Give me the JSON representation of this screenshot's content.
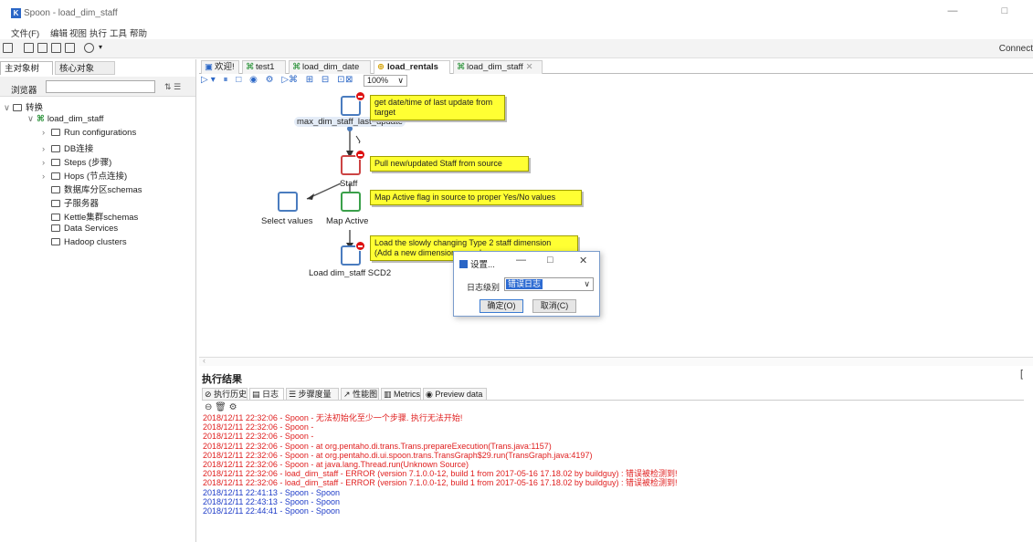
{
  "window": {
    "title": "Spoon - load_dim_staff",
    "minimize": "—",
    "maximize": "□"
  },
  "menu": [
    "文件(F)",
    "编辑",
    "视图",
    "执行",
    "工具",
    "帮助"
  ],
  "toolbar": {
    "connect": "Connect"
  },
  "left_panel": {
    "tabs": [
      "主对象树",
      "核心对象"
    ],
    "browser_label": "浏览器",
    "search_placeholder": "",
    "tree": {
      "root": "转换",
      "transformation": "load_dim_staff",
      "children": [
        "Run configurations",
        "DB连接",
        "Steps (步骤)",
        "Hops (节点连接)",
        "数据库分区schemas",
        "子服务器",
        "Kettle集群schemas",
        "Data Services",
        "Hadoop clusters"
      ]
    }
  },
  "editor_tabs": [
    "欢迎!",
    "test1",
    "load_dim_date",
    "load_rentals",
    "load_dim_staff"
  ],
  "zoom": "100%",
  "canvas": {
    "notes": [
      "get date/time of last update from target",
      "Pull new/updated Staff from source",
      "Map Active flag in source to proper Yes/No values",
      "Load the slowly changing Type 2 staff dimension",
      "(Add a new dimension record..."
    ],
    "steps": [
      "max_dim_staff_last_update",
      "Staff",
      "Select values",
      "Map Active",
      "Load dim_staff SCD2"
    ]
  },
  "dialog": {
    "title": "设置...",
    "level_label": "日志级别",
    "level_value": "错误日志",
    "ok": "确定(O)",
    "cancel": "取消(C)"
  },
  "results": {
    "title": "执行结果",
    "tabs": [
      "执行历史",
      "日志",
      "步骤度量",
      "性能图",
      "Metrics",
      "Preview data"
    ],
    "log_lines": [
      {
        "text": "2018/12/11 22:32:06 - Spoon - 无法初始化至少一个步骤. 执行无法开始!",
        "color": "red"
      },
      {
        "text": "2018/12/11 22:32:06 - Spoon -",
        "color": "red"
      },
      {
        "text": "2018/12/11 22:32:06 - Spoon -",
        "color": "red"
      },
      {
        "text": "2018/12/11 22:32:06 - Spoon -    at org.pentaho.di.trans.Trans.prepareExecution(Trans.java:1157)",
        "color": "red"
      },
      {
        "text": "2018/12/11 22:32:06 - Spoon -    at org.pentaho.di.ui.spoon.trans.TransGraph$29.run(TransGraph.java:4197)",
        "color": "red"
      },
      {
        "text": "2018/12/11 22:32:06 - Spoon -    at java.lang.Thread.run(Unknown Source)",
        "color": "red"
      },
      {
        "text": "2018/12/11 22:32:06 - load_dim_staff - ERROR (version 7.1.0.0-12, build 1 from 2017-05-16 17.18.02 by buildguy) : 错误被检测到!",
        "color": "red"
      },
      {
        "text": "2018/12/11 22:32:06 - load_dim_staff - ERROR (version 7.1.0.0-12, build 1 from 2017-05-16 17.18.02 by buildguy) : 错误被检测到!",
        "color": "red"
      },
      {
        "text": "2018/12/11 22:41:13 - Spoon - Spoon",
        "color": "blue"
      },
      {
        "text": "2018/12/11 22:43:13 - Spoon - Spoon",
        "color": "blue"
      },
      {
        "text": "2018/12/11 22:44:41 - Spoon - Spoon",
        "color": "blue"
      }
    ]
  }
}
